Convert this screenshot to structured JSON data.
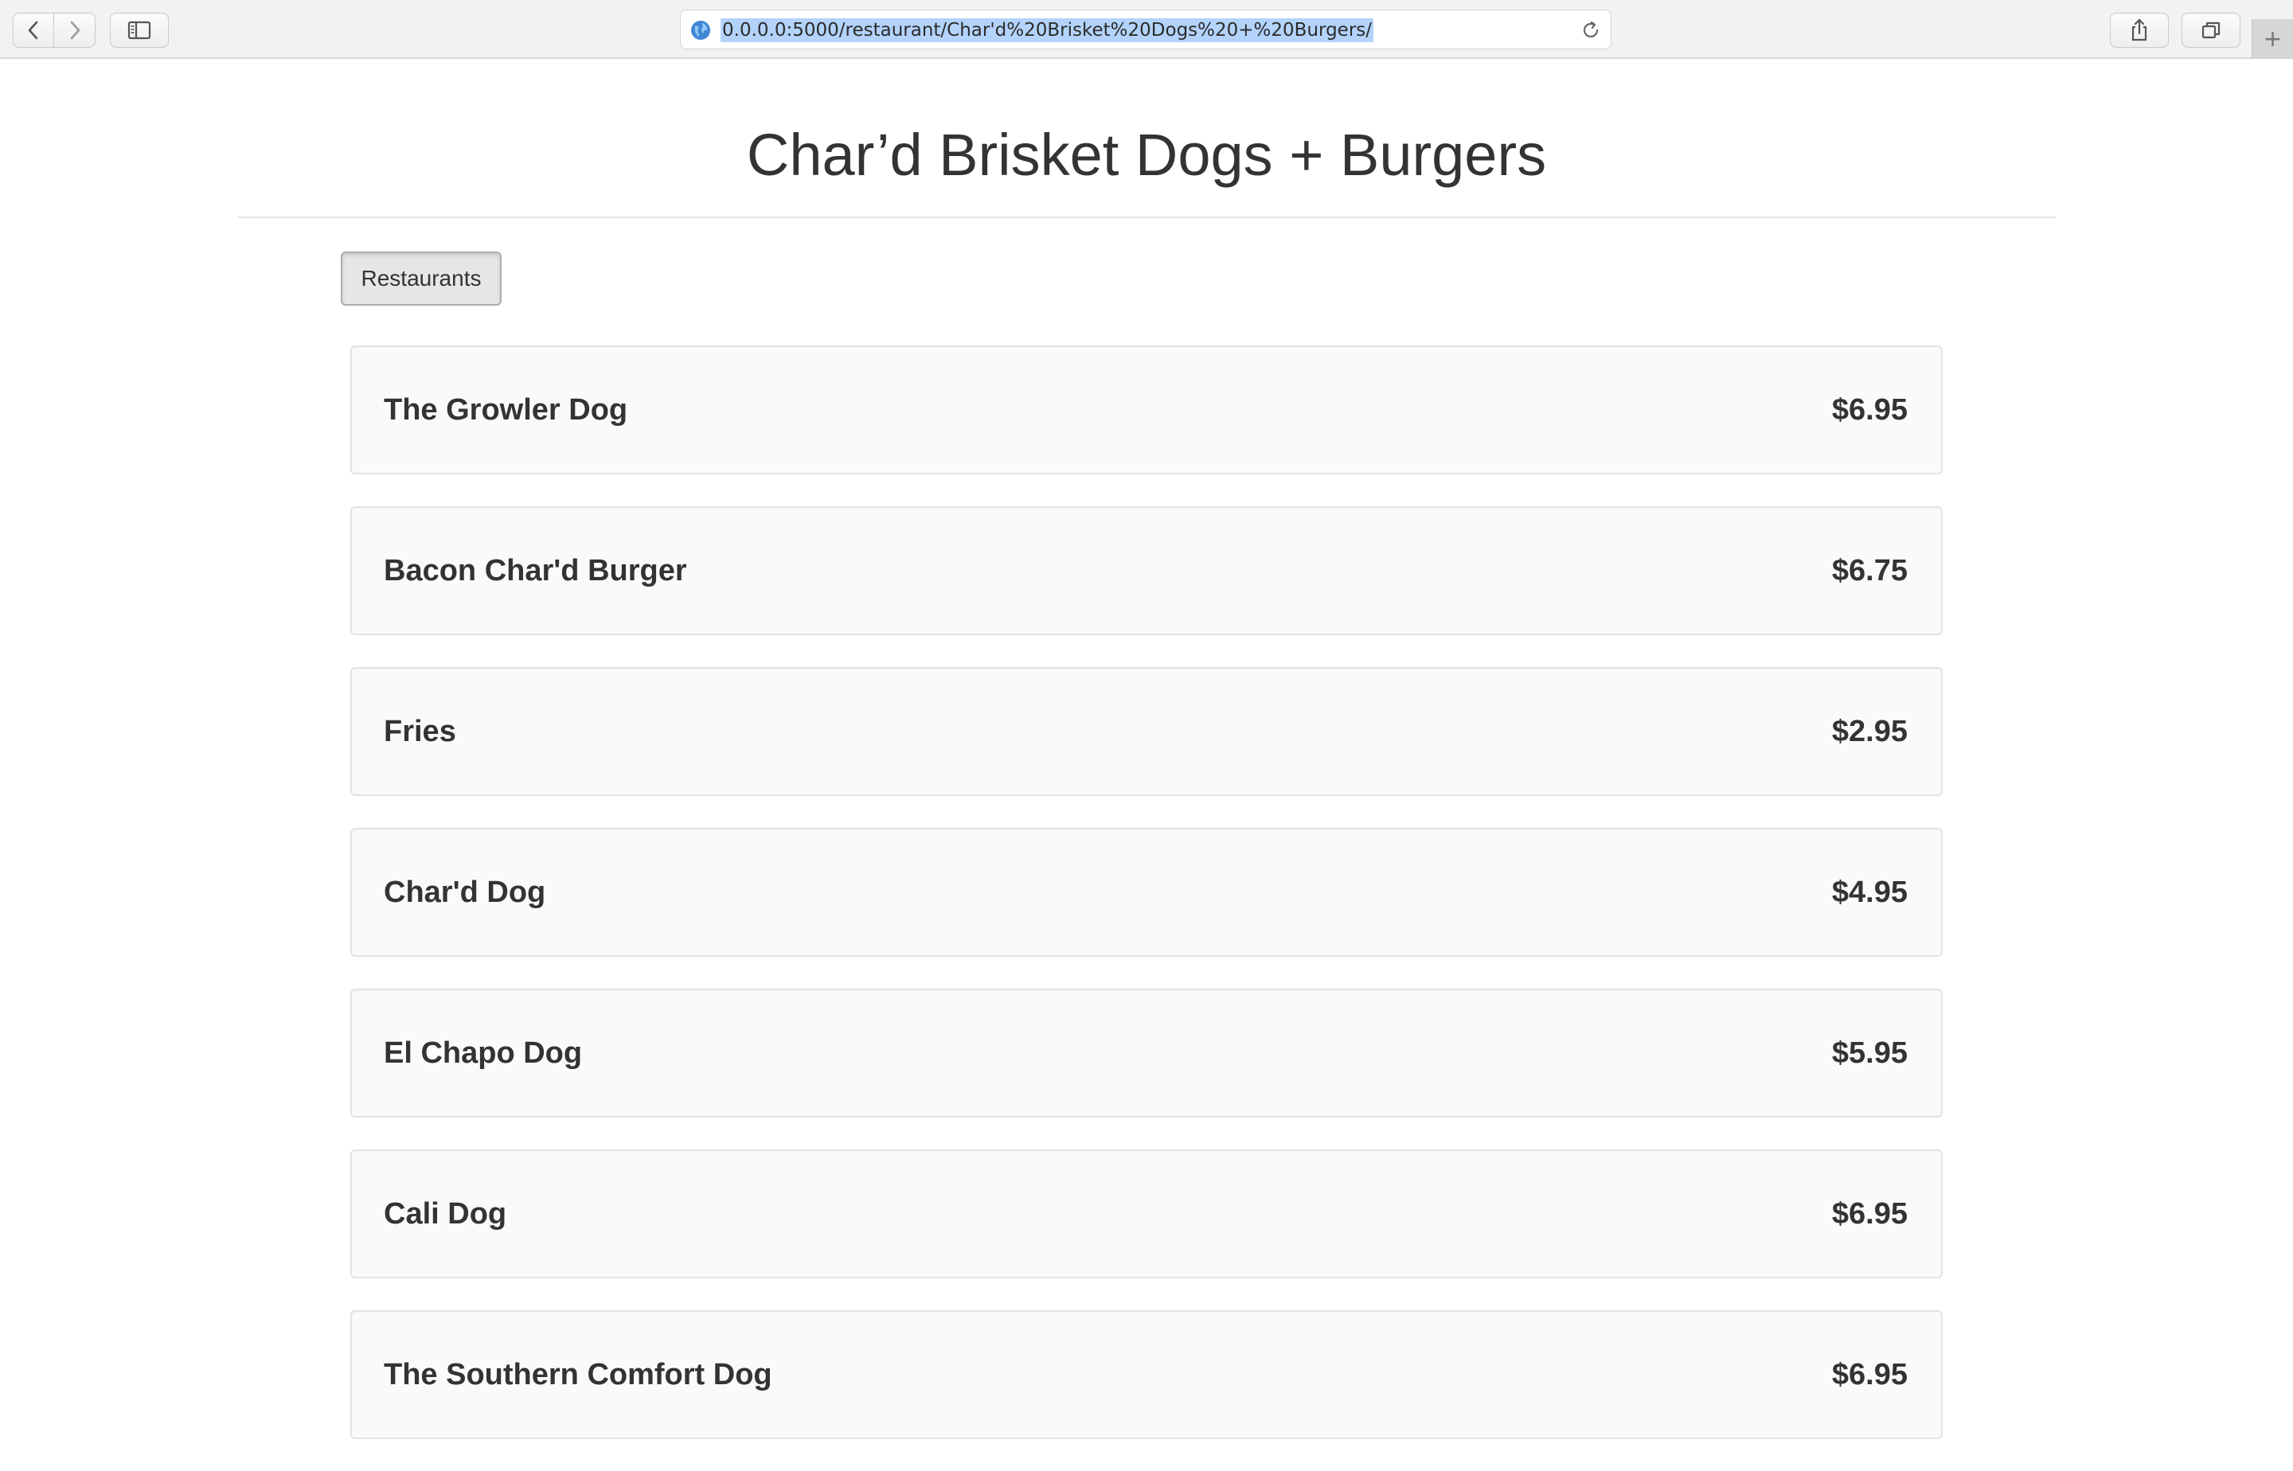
{
  "browser": {
    "url": "0.0.0.0:5000/restaurant/Char'd%20Brisket%20Dogs%20+%20Burgers/",
    "new_tab_label": "+"
  },
  "page": {
    "title": "Char’d Brisket Dogs + Burgers",
    "restaurants_button_label": "Restaurants"
  },
  "menu": {
    "items": [
      {
        "name": "The Growler Dog",
        "price": "$6.95"
      },
      {
        "name": "Bacon Char'd Burger",
        "price": "$6.75"
      },
      {
        "name": "Fries",
        "price": "$2.95"
      },
      {
        "name": "Char'd Dog",
        "price": "$4.95"
      },
      {
        "name": "El Chapo Dog",
        "price": "$5.95"
      },
      {
        "name": "Cali Dog",
        "price": "$6.95"
      },
      {
        "name": "The Southern Comfort Dog",
        "price": "$6.95"
      }
    ]
  },
  "icons": {
    "back": "chevron-left-icon",
    "forward": "chevron-right-icon",
    "sidebar": "sidebar-icon",
    "site": "globe-icon",
    "reload": "reload-icon",
    "share": "share-icon",
    "tabs": "tabs-overview-icon"
  },
  "colors": {
    "url_selection": "#b3d3fb",
    "card_background": "#fafafa",
    "text": "#333333"
  }
}
